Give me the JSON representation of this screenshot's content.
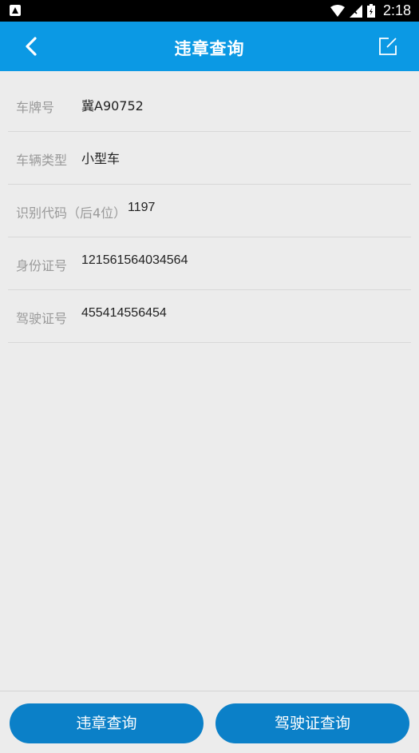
{
  "status_bar": {
    "time": "2:18",
    "left_icon": "notification-app-icon",
    "icons": [
      "wifi-icon",
      "signal-icon",
      "battery-icon"
    ]
  },
  "header": {
    "title": "违章查询",
    "back_icon": "chevron-left-icon",
    "edit_icon": "edit-icon",
    "background": "#0b99e4"
  },
  "form": {
    "rows": [
      {
        "label": "车牌号",
        "value": "冀A90752"
      },
      {
        "label": "车辆类型",
        "value": "小型车"
      },
      {
        "label": "识别代码（后4位）",
        "value": "1197"
      },
      {
        "label": "身份证号",
        "value": "121561564034564"
      },
      {
        "label": "驾驶证号",
        "value": "455414556454"
      }
    ]
  },
  "bottom": {
    "violation_query_label": "违章查询",
    "license_query_label": "驾驶证查询",
    "button_color": "#0b80c8"
  }
}
